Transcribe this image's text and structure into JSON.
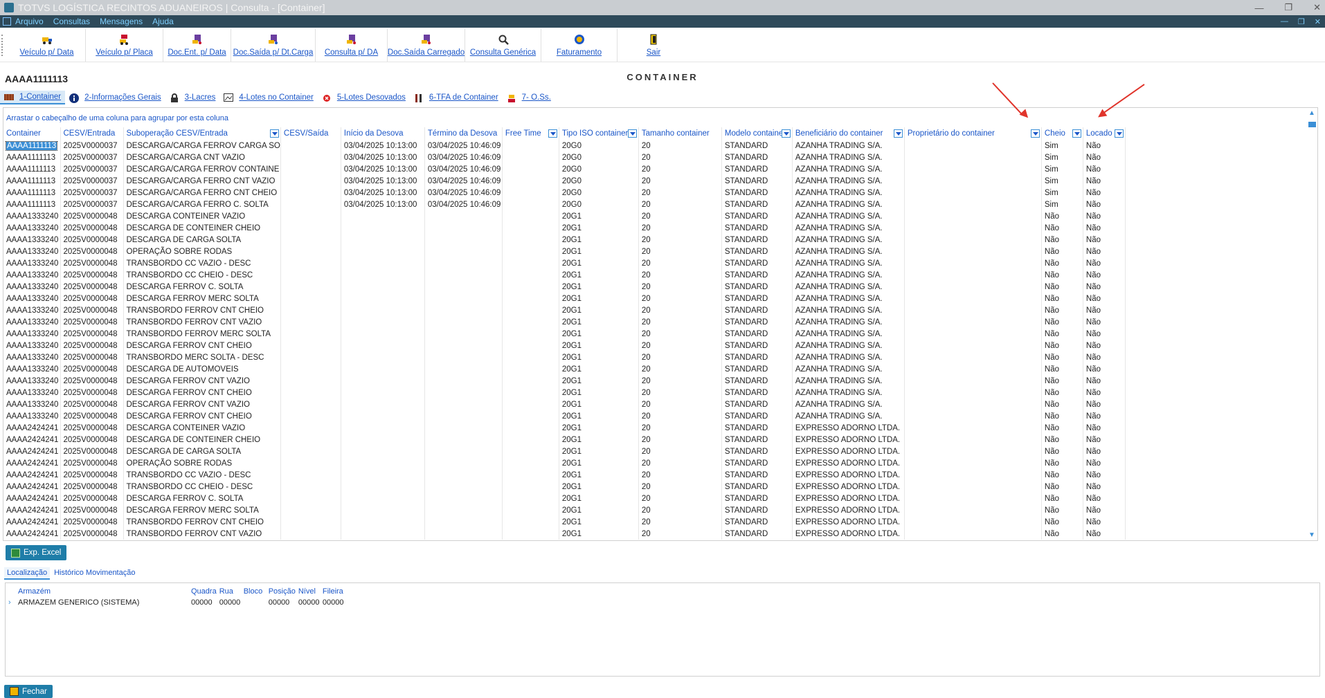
{
  "window": {
    "title": "TOTVS LOGÍSTICA RECINTOS ADUANEIROS | Consulta - [Container]"
  },
  "menu": [
    "Arquivo",
    "Consultas",
    "Mensagens",
    "Ajuda"
  ],
  "toolbar": [
    {
      "label": "Veículo p/ Data",
      "icon": "truck-icon"
    },
    {
      "label": "Veículo p/ Placa",
      "icon": "truck-plate-icon"
    },
    {
      "label": "Doc.Ent. p/ Data",
      "icon": "document-entry-icon"
    },
    {
      "label": "Doc.Saída p/ Dt.Carga",
      "icon": "document-exit-icon"
    },
    {
      "label": "Consulta p/ DA",
      "icon": "query-da-icon"
    },
    {
      "label": "Doc.Saída Carregado",
      "icon": "document-loaded-icon"
    },
    {
      "label": "Consulta Genérica",
      "icon": "search-icon"
    },
    {
      "label": "Faturamento",
      "icon": "billing-icon"
    },
    {
      "label": "Sair",
      "icon": "exit-icon"
    }
  ],
  "page_title": "CONTAINER",
  "container_id": "AAAA1111113",
  "tabs": [
    {
      "label": "1-Container",
      "icon": "container-icon"
    },
    {
      "label": "2-Informações Gerais",
      "icon": "info-icon"
    },
    {
      "label": "3-Lacres",
      "icon": "lock-icon"
    },
    {
      "label": "4-Lotes no Container",
      "icon": "image-icon"
    },
    {
      "label": "5-Lotes Desovados",
      "icon": "cancel-icon"
    },
    {
      "label": "6-TFA de Container",
      "icon": "tools-icon"
    },
    {
      "label": "7- O.Ss.",
      "icon": "worker-icon"
    }
  ],
  "grid": {
    "group_hint": "Arrastar o cabeçalho de uma coluna para agrupar por esta coluna",
    "columns": [
      "Container",
      "CESV/Entrada",
      "Suboperação CESV/Entrada",
      "CESV/Saída",
      "Início da Desova",
      "Término da Desova",
      "Free Time",
      "Tipo ISO container",
      "Tamanho container",
      "Modelo container",
      "Beneficiário do container",
      "Proprietário do container",
      "Cheio",
      "Locado"
    ],
    "rows": [
      [
        "AAAA1111113",
        "2025V0000037",
        "DESCARGA/CARGA FERROV CARGA SO",
        "",
        "03/04/2025 10:13:00",
        "03/04/2025 10:46:09",
        "",
        "20G0",
        "20",
        "STANDARD",
        "AZANHA TRADING S/A.",
        "",
        "Sim",
        "Não"
      ],
      [
        "AAAA1111113",
        "2025V0000037",
        "DESCARGA/CARGA CNT VAZIO",
        "",
        "03/04/2025 10:13:00",
        "03/04/2025 10:46:09",
        "",
        "20G0",
        "20",
        "STANDARD",
        "AZANHA TRADING S/A.",
        "",
        "Sim",
        "Não"
      ],
      [
        "AAAA1111113",
        "2025V0000037",
        "DESCARGA/CARGA FERROV CONTAINE",
        "",
        "03/04/2025 10:13:00",
        "03/04/2025 10:46:09",
        "",
        "20G0",
        "20",
        "STANDARD",
        "AZANHA TRADING S/A.",
        "",
        "Sim",
        "Não"
      ],
      [
        "AAAA1111113",
        "2025V0000037",
        "DESCARGA/CARGA FERRO CNT VAZIO",
        "",
        "03/04/2025 10:13:00",
        "03/04/2025 10:46:09",
        "",
        "20G0",
        "20",
        "STANDARD",
        "AZANHA TRADING S/A.",
        "",
        "Sim",
        "Não"
      ],
      [
        "AAAA1111113",
        "2025V0000037",
        "DESCARGA/CARGA FERRO CNT CHEIO",
        "",
        "03/04/2025 10:13:00",
        "03/04/2025 10:46:09",
        "",
        "20G0",
        "20",
        "STANDARD",
        "AZANHA TRADING S/A.",
        "",
        "Sim",
        "Não"
      ],
      [
        "AAAA1111113",
        "2025V0000037",
        "DESCARGA/CARGA FERRO C. SOLTA",
        "",
        "03/04/2025 10:13:00",
        "03/04/2025 10:46:09",
        "",
        "20G0",
        "20",
        "STANDARD",
        "AZANHA TRADING S/A.",
        "",
        "Sim",
        "Não"
      ],
      [
        "AAAA1333240",
        "2025V0000048",
        "DESCARGA CONTEINER VAZIO",
        "",
        "",
        "",
        "",
        "20G1",
        "20",
        "STANDARD",
        "AZANHA TRADING S/A.",
        "",
        "Não",
        "Não"
      ],
      [
        "AAAA1333240",
        "2025V0000048",
        "DESCARGA DE CONTEINER CHEIO",
        "",
        "",
        "",
        "",
        "20G1",
        "20",
        "STANDARD",
        "AZANHA TRADING S/A.",
        "",
        "Não",
        "Não"
      ],
      [
        "AAAA1333240",
        "2025V0000048",
        "DESCARGA DE CARGA SOLTA",
        "",
        "",
        "",
        "",
        "20G1",
        "20",
        "STANDARD",
        "AZANHA TRADING S/A.",
        "",
        "Não",
        "Não"
      ],
      [
        "AAAA1333240",
        "2025V0000048",
        "OPERAÇÃO SOBRE RODAS",
        "",
        "",
        "",
        "",
        "20G1",
        "20",
        "STANDARD",
        "AZANHA TRADING S/A.",
        "",
        "Não",
        "Não"
      ],
      [
        "AAAA1333240",
        "2025V0000048",
        "TRANSBORDO CC VAZIO - DESC",
        "",
        "",
        "",
        "",
        "20G1",
        "20",
        "STANDARD",
        "AZANHA TRADING S/A.",
        "",
        "Não",
        "Não"
      ],
      [
        "AAAA1333240",
        "2025V0000048",
        "TRANSBORDO CC CHEIO - DESC",
        "",
        "",
        "",
        "",
        "20G1",
        "20",
        "STANDARD",
        "AZANHA TRADING S/A.",
        "",
        "Não",
        "Não"
      ],
      [
        "AAAA1333240",
        "2025V0000048",
        "DESCARGA FERROV C. SOLTA",
        "",
        "",
        "",
        "",
        "20G1",
        "20",
        "STANDARD",
        "AZANHA TRADING S/A.",
        "",
        "Não",
        "Não"
      ],
      [
        "AAAA1333240",
        "2025V0000048",
        "DESCARGA FERROV MERC SOLTA",
        "",
        "",
        "",
        "",
        "20G1",
        "20",
        "STANDARD",
        "AZANHA TRADING S/A.",
        "",
        "Não",
        "Não"
      ],
      [
        "AAAA1333240",
        "2025V0000048",
        "TRANSBORDO FERROV CNT CHEIO",
        "",
        "",
        "",
        "",
        "20G1",
        "20",
        "STANDARD",
        "AZANHA TRADING S/A.",
        "",
        "Não",
        "Não"
      ],
      [
        "AAAA1333240",
        "2025V0000048",
        "TRANSBORDO FERROV CNT VAZIO",
        "",
        "",
        "",
        "",
        "20G1",
        "20",
        "STANDARD",
        "AZANHA TRADING S/A.",
        "",
        "Não",
        "Não"
      ],
      [
        "AAAA1333240",
        "2025V0000048",
        "TRANSBORDO FERROV MERC SOLTA",
        "",
        "",
        "",
        "",
        "20G1",
        "20",
        "STANDARD",
        "AZANHA TRADING S/A.",
        "",
        "Não",
        "Não"
      ],
      [
        "AAAA1333240",
        "2025V0000048",
        "DESCARGA FERROV CNT CHEIO",
        "",
        "",
        "",
        "",
        "20G1",
        "20",
        "STANDARD",
        "AZANHA TRADING S/A.",
        "",
        "Não",
        "Não"
      ],
      [
        "AAAA1333240",
        "2025V0000048",
        "TRANSBORDO MERC SOLTA - DESC",
        "",
        "",
        "",
        "",
        "20G1",
        "20",
        "STANDARD",
        "AZANHA TRADING S/A.",
        "",
        "Não",
        "Não"
      ],
      [
        "AAAA1333240",
        "2025V0000048",
        "DESCARGA DE AUTOMOVEIS",
        "",
        "",
        "",
        "",
        "20G1",
        "20",
        "STANDARD",
        "AZANHA TRADING S/A.",
        "",
        "Não",
        "Não"
      ],
      [
        "AAAA1333240",
        "2025V0000048",
        "DESCARGA FERROV CNT VAZIO",
        "",
        "",
        "",
        "",
        "20G1",
        "20",
        "STANDARD",
        "AZANHA TRADING S/A.",
        "",
        "Não",
        "Não"
      ],
      [
        "AAAA1333240",
        "2025V0000048",
        "DESCARGA FERROV CNT CHEIO",
        "",
        "",
        "",
        "",
        "20G1",
        "20",
        "STANDARD",
        "AZANHA TRADING S/A.",
        "",
        "Não",
        "Não"
      ],
      [
        "AAAA1333240",
        "2025V0000048",
        "DESCARGA FERROV CNT VAZIO",
        "",
        "",
        "",
        "",
        "20G1",
        "20",
        "STANDARD",
        "AZANHA TRADING S/A.",
        "",
        "Não",
        "Não"
      ],
      [
        "AAAA1333240",
        "2025V0000048",
        "DESCARGA FERROV CNT CHEIO",
        "",
        "",
        "",
        "",
        "20G1",
        "20",
        "STANDARD",
        "AZANHA TRADING S/A.",
        "",
        "Não",
        "Não"
      ],
      [
        "AAAA2424241",
        "2025V0000048",
        "DESCARGA CONTEINER VAZIO",
        "",
        "",
        "",
        "",
        "20G1",
        "20",
        "STANDARD",
        "EXPRESSO ADORNO LTDA.",
        "",
        "Não",
        "Não"
      ],
      [
        "AAAA2424241",
        "2025V0000048",
        "DESCARGA DE CONTEINER CHEIO",
        "",
        "",
        "",
        "",
        "20G1",
        "20",
        "STANDARD",
        "EXPRESSO ADORNO LTDA.",
        "",
        "Não",
        "Não"
      ],
      [
        "AAAA2424241",
        "2025V0000048",
        "DESCARGA DE CARGA SOLTA",
        "",
        "",
        "",
        "",
        "20G1",
        "20",
        "STANDARD",
        "EXPRESSO ADORNO LTDA.",
        "",
        "Não",
        "Não"
      ],
      [
        "AAAA2424241",
        "2025V0000048",
        "OPERAÇÃO SOBRE RODAS",
        "",
        "",
        "",
        "",
        "20G1",
        "20",
        "STANDARD",
        "EXPRESSO ADORNO LTDA.",
        "",
        "Não",
        "Não"
      ],
      [
        "AAAA2424241",
        "2025V0000048",
        "TRANSBORDO CC VAZIO - DESC",
        "",
        "",
        "",
        "",
        "20G1",
        "20",
        "STANDARD",
        "EXPRESSO ADORNO LTDA.",
        "",
        "Não",
        "Não"
      ],
      [
        "AAAA2424241",
        "2025V0000048",
        "TRANSBORDO CC CHEIO - DESC",
        "",
        "",
        "",
        "",
        "20G1",
        "20",
        "STANDARD",
        "EXPRESSO ADORNO LTDA.",
        "",
        "Não",
        "Não"
      ],
      [
        "AAAA2424241",
        "2025V0000048",
        "DESCARGA FERROV C. SOLTA",
        "",
        "",
        "",
        "",
        "20G1",
        "20",
        "STANDARD",
        "EXPRESSO ADORNO LTDA.",
        "",
        "Não",
        "Não"
      ],
      [
        "AAAA2424241",
        "2025V0000048",
        "DESCARGA FERROV MERC SOLTA",
        "",
        "",
        "",
        "",
        "20G1",
        "20",
        "STANDARD",
        "EXPRESSO ADORNO LTDA.",
        "",
        "Não",
        "Não"
      ],
      [
        "AAAA2424241",
        "2025V0000048",
        "TRANSBORDO FERROV CNT CHEIO",
        "",
        "",
        "",
        "",
        "20G1",
        "20",
        "STANDARD",
        "EXPRESSO ADORNO LTDA.",
        "",
        "Não",
        "Não"
      ],
      [
        "AAAA2424241",
        "2025V0000048",
        "TRANSBORDO FERROV CNT VAZIO",
        "",
        "",
        "",
        "",
        "20G1",
        "20",
        "STANDARD",
        "EXPRESSO ADORNO LTDA.",
        "",
        "Não",
        "Não"
      ]
    ]
  },
  "export_button": "Exp. Excel",
  "subtabs": [
    "Localização",
    "Histórico Movimentação"
  ],
  "location": {
    "columns": [
      "Armazém",
      "Quadra",
      "Rua",
      "Bloco",
      "Posição",
      "Nível",
      "Fileira"
    ],
    "rows": [
      [
        "ARMAZEM GENERICO (SISTEMA)",
        "00000",
        "00000",
        "",
        "00000",
        "00000",
        "00000"
      ]
    ]
  },
  "close_button": "Fechar",
  "colors": {
    "accent": "#1f7da8",
    "link": "#1a56c8",
    "menubar": "#2e4a5a",
    "annotation_arrow": "#e0342b"
  }
}
